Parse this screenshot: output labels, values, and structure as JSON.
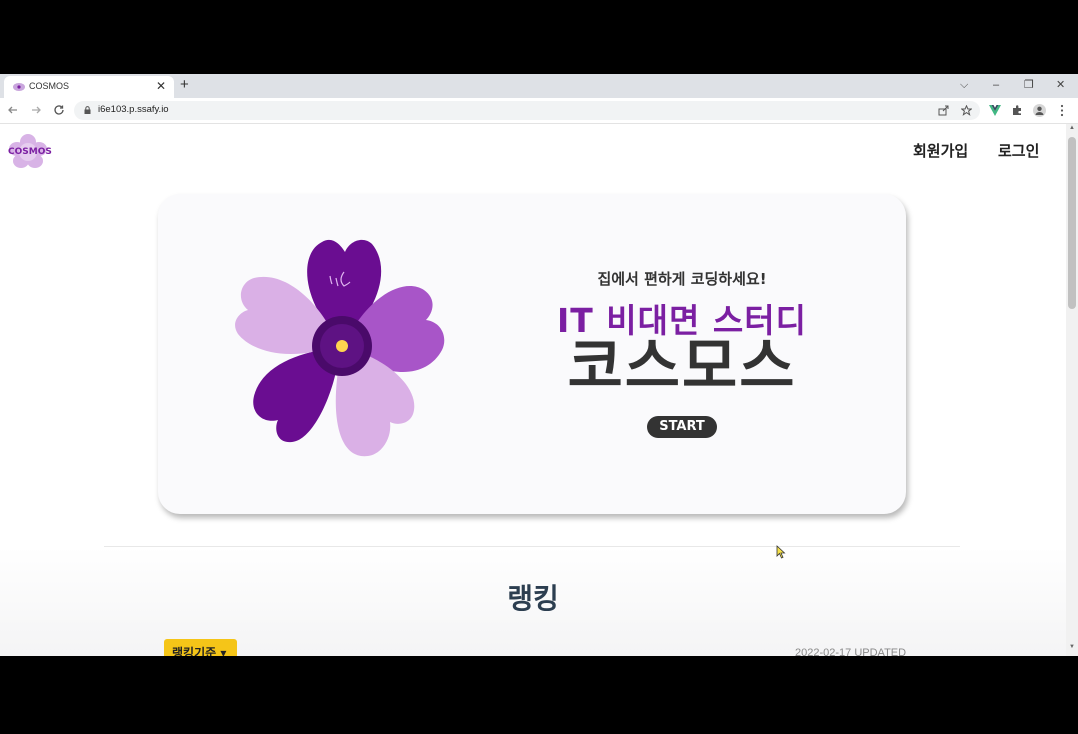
{
  "browser": {
    "tab_title": "COSMOS",
    "new_tab": "+",
    "tab_close": "✕",
    "url": "i6e103.p.ssafy.io",
    "window_controls": [
      "⌵",
      "–",
      "❐",
      "✕"
    ]
  },
  "header": {
    "logo_text": "COSMOS",
    "nav": [
      {
        "label": "회원가입"
      },
      {
        "label": "로그인"
      }
    ]
  },
  "hero": {
    "subtitle": "집에서 편하게 코딩하세요!",
    "title": "IT 비대면 스터디",
    "brand": "코스모스",
    "start_label": "START"
  },
  "ranking": {
    "title": "랭킹",
    "dropdown_label": "랭킹기준 ▾",
    "updated": "2022-02-17 UPDATED"
  },
  "colors": {
    "brand_purple": "#7b1fa2",
    "light_purple": "#dab0e6",
    "mid_purple": "#a855c8",
    "dark_purple": "#6a0d91",
    "accent_yellow": "#f5c518"
  },
  "icons": {
    "nav_back": "arrow-left-icon",
    "nav_forward": "arrow-right-icon",
    "reload": "reload-icon",
    "lock": "lock-icon",
    "share": "share-icon",
    "bookmark": "star-icon",
    "extension_vue": "vue-icon",
    "extensions": "puzzle-icon",
    "profile": "profile-icon",
    "menu": "kebab-menu-icon"
  }
}
